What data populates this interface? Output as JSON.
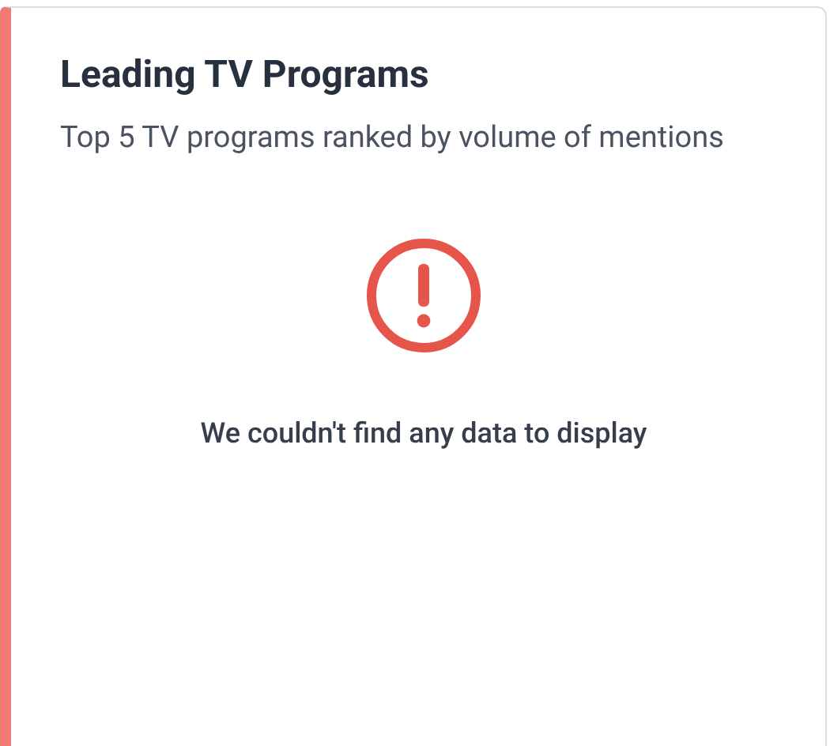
{
  "card": {
    "title": "Leading TV Programs",
    "subtitle": "Top 5 TV programs ranked by volume of mentions",
    "empty_message": "We couldn't find any data to display"
  }
}
